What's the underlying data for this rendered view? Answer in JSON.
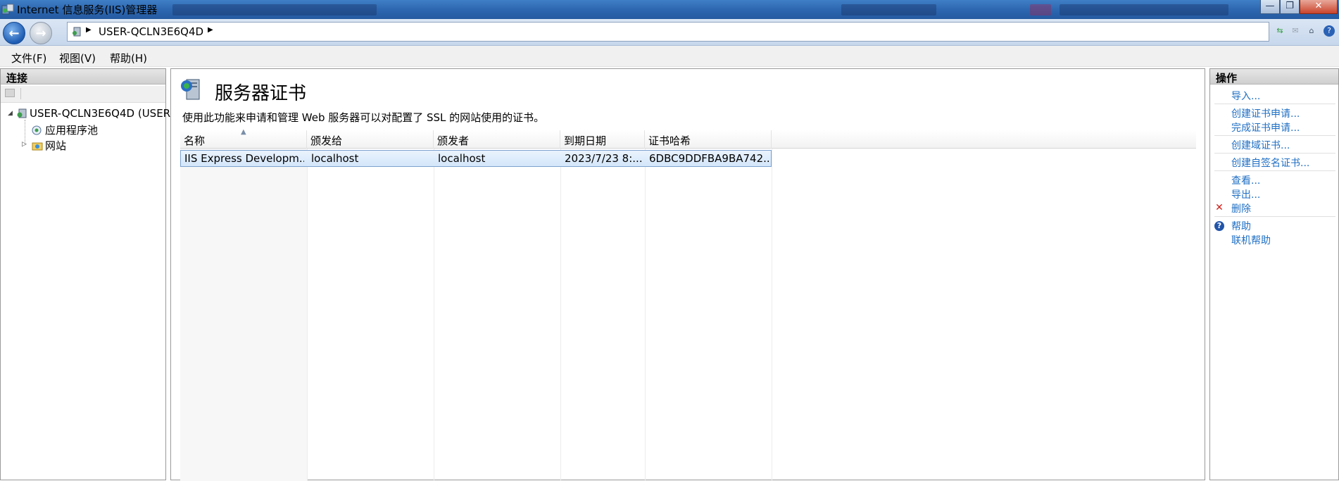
{
  "window": {
    "title": "Internet 信息服务(IIS)管理器",
    "controls": {
      "minimize": "—",
      "maximize": "❐",
      "close": "✕"
    }
  },
  "navigation": {
    "breadcrumb": "USER-QCLN3E6Q4D",
    "icons": [
      "back-arrow-icon",
      "forward-arrow-icon",
      "server-icon",
      "refresh-icon",
      "stop-icon",
      "home-icon",
      "help-icon"
    ]
  },
  "menu": {
    "items": [
      "文件(F)",
      "视图(V)",
      "帮助(H)"
    ]
  },
  "connections": {
    "header": "连接",
    "tree": [
      {
        "label": "USER-QCLN3E6Q4D (USER",
        "level": 0,
        "icon": "server-icon",
        "expanded": true
      },
      {
        "label": "应用程序池",
        "level": 1,
        "icon": "app-pool-icon",
        "expanded": null
      },
      {
        "label": "网站",
        "level": 1,
        "icon": "sites-folder-icon",
        "expanded": false
      }
    ]
  },
  "main": {
    "title": "服务器证书",
    "description": "使用此功能来申请和管理 Web 服务器可以对配置了 SSL 的网站使用的证书。",
    "columns": [
      "名称",
      "颁发给",
      "颁发者",
      "到期日期",
      "证书哈希"
    ],
    "rows": [
      [
        "IIS Express Developm...",
        "localhost",
        "localhost",
        "2023/7/23 8:...",
        "6DBC9DDFBA9BA742..."
      ]
    ]
  },
  "actions": {
    "header": "操作",
    "groups": [
      [
        "导入..."
      ],
      [
        "创建证书申请...",
        "完成证书申请..."
      ],
      [
        "创建域证书..."
      ],
      [
        "创建自签名证书..."
      ],
      [
        "查看...",
        "导出...",
        "删除"
      ],
      [
        "帮助",
        "联机帮助"
      ]
    ],
    "colors": {
      "link": "#1f6fc4",
      "delete": "#d0201b",
      "help": "#2255a8"
    }
  }
}
